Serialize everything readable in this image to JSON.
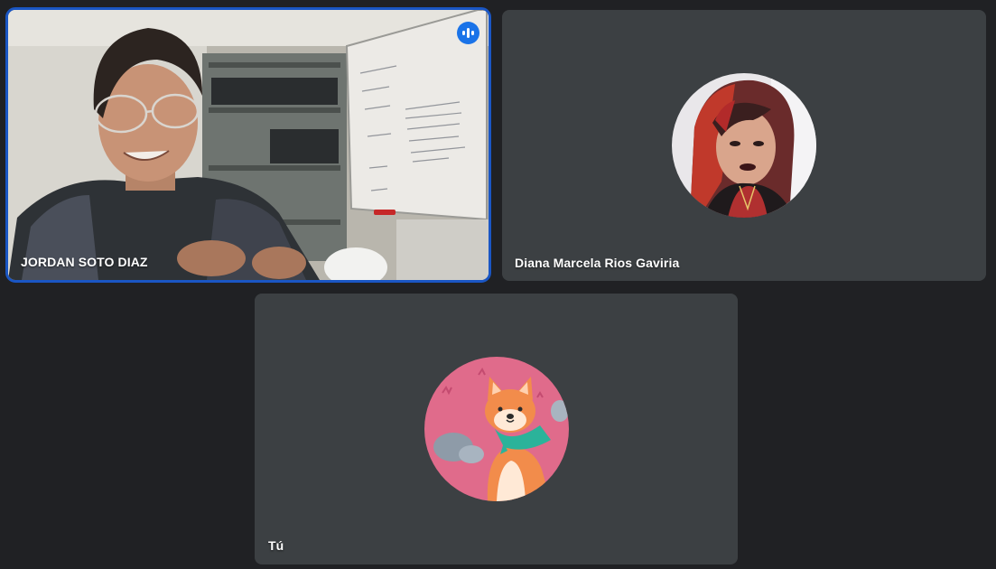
{
  "participants": [
    {
      "name": "JORDAN SOTO DIAZ",
      "state": "video",
      "speaking": true,
      "speaking_icon": "audio-level-icon"
    },
    {
      "name": "Diana Marcela Rios Gaviria",
      "state": "avatar",
      "avatar": "profile-photo"
    },
    {
      "name": "Tú",
      "state": "avatar",
      "avatar": "shiba-inu-illustration"
    }
  ],
  "colors": {
    "background": "#202124",
    "tile": "#3c4043",
    "speaking_outline": "#1a56c4",
    "speaking_badge": "#1a73e8",
    "label_text": "#ffffff"
  }
}
